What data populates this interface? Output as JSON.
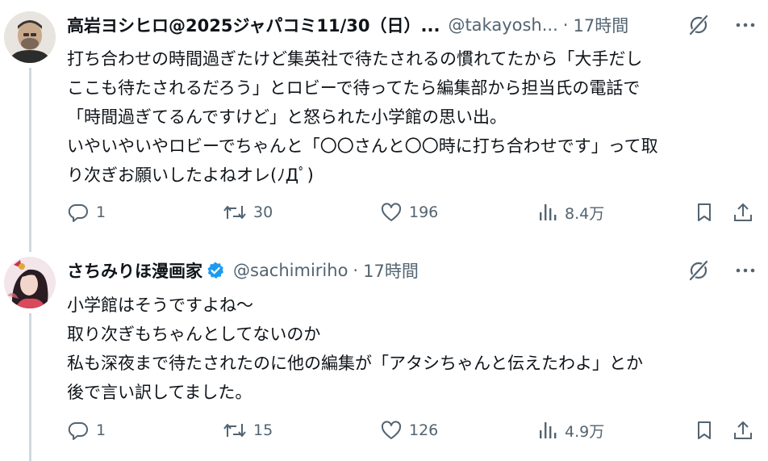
{
  "tweets": [
    {
      "display_name": "高岩ヨシヒロ@2025ジャパコミ11/30（日）...",
      "handle": "@takayosh...",
      "separator": "·",
      "time": "17時間",
      "verified": false,
      "body_lines": [
        "打ち合わせの時間過ぎたけど集英社で待たされるの慣れてたから「大手だし",
        "ここも待たされるだろう」とロビーで待ってたら編集部から担当氏の電話で",
        "「時間過ぎてるんですけど」と怒られた小学館の思い出。",
        "いやいやいやロビーでちゃんと「〇〇さんと〇〇時に打ち合わせです」って取",
        "り次ぎお願いしたよねオレ(ﾉДﾟ)"
      ],
      "stats": {
        "replies": "1",
        "retweets": "30",
        "likes": "196",
        "views": "8.4万"
      }
    },
    {
      "display_name": "さちみりほ漫画家",
      "handle": "@sachimiriho",
      "separator": "·",
      "time": "17時間",
      "verified": true,
      "body_lines": [
        "小学館はそうですよね～",
        "取り次ぎもちゃんとしてないのか",
        "私も深夜まで待たされたのに他の編集が「アタシちゃんと伝えたわよ」とか",
        "後で言い訳してました。"
      ],
      "stats": {
        "replies": "1",
        "retweets": "15",
        "likes": "126",
        "views": "4.9万"
      }
    }
  ],
  "icons": {
    "grok": "grok-icon",
    "more": "more-icon",
    "reply": "reply-icon",
    "retweet": "retweet-icon",
    "like": "heart-icon",
    "views": "views-chart-icon",
    "bookmark": "bookmark-icon",
    "share": "share-icon",
    "verified": "verified-badge-icon"
  },
  "colors": {
    "text": "#0f1419",
    "secondary": "#536471",
    "verified": "#1d9bf0",
    "thread_line": "#cfd9de"
  }
}
